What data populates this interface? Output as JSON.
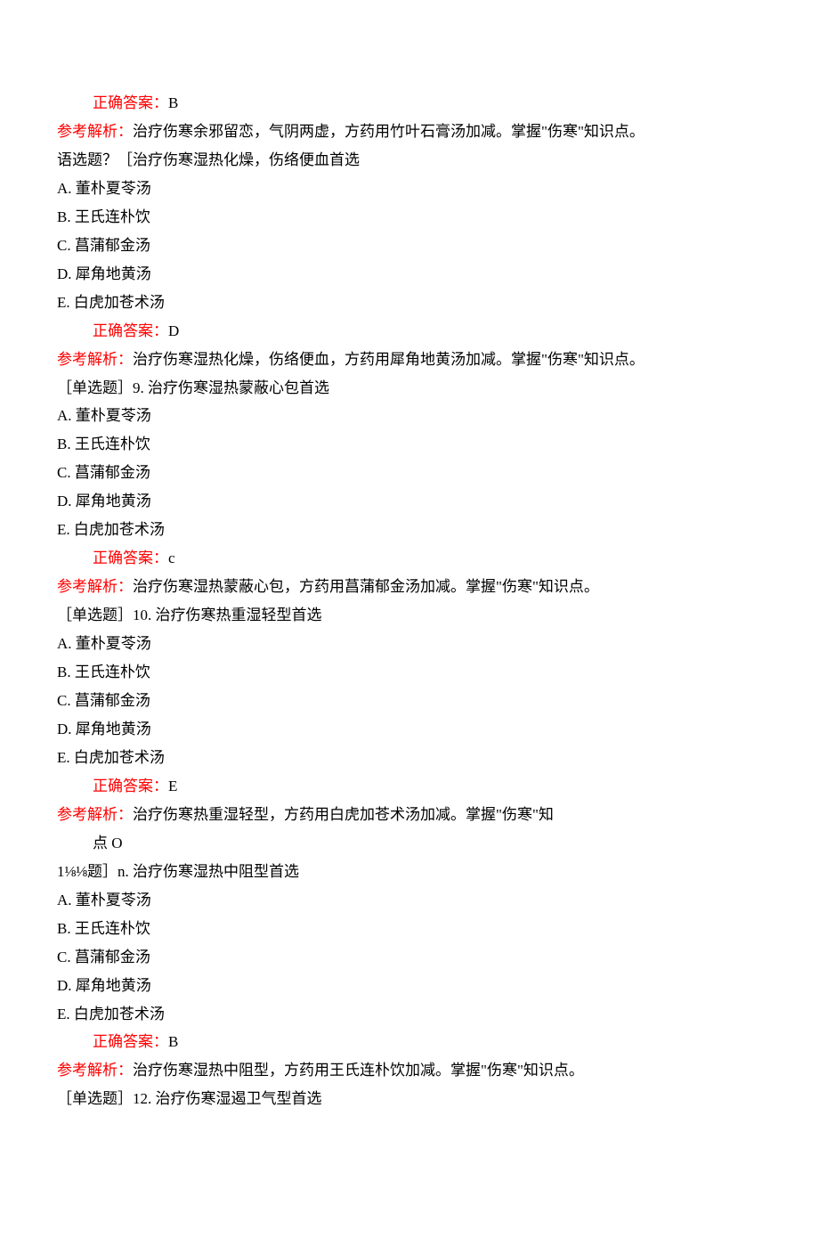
{
  "block_top": {
    "answer_label": "正确答案：",
    "answer_value": "B",
    "explain_label": "参考解析：",
    "explain_text": "治疗伤寒余邪留恋，气阴两虚，方药用竹叶石膏汤加减。掌握\"伤寒\"知识点。"
  },
  "q8": {
    "stem": "语选题？［治疗伤寒湿热化燥，伤络便血首选",
    "options": [
      "A. 董朴夏苓汤",
      "B. 王氏连朴饮",
      "C. 菖蒲郁金汤",
      "D. 犀角地黄汤",
      "E. 白虎加苍术汤"
    ],
    "answer_label": "正确答案：",
    "answer_value": "D",
    "explain_label": "参考解析：",
    "explain_text": "治疗伤寒湿热化燥，伤络便血，方药用犀角地黄汤加减。掌握\"伤寒\"知识点。"
  },
  "q9": {
    "stem": "［单选题］9. 治疗伤寒湿热蒙蔽心包首选",
    "options": [
      "A. 董朴夏苓汤",
      "B. 王氏连朴饮",
      "C. 菖蒲郁金汤",
      "D. 犀角地黄汤",
      "E. 白虎加苍术汤"
    ],
    "answer_label": "正确答案：",
    "answer_value": "c",
    "explain_label": "参考解析：",
    "explain_text": "治疗伤寒湿热蒙蔽心包，方药用菖蒲郁金汤加减。掌握\"伤寒\"知识点。"
  },
  "q10": {
    "stem": "［单选题］10. 治疗伤寒热重湿轻型首选",
    "options": [
      "A. 董朴夏苓汤",
      "B. 王氏连朴饮",
      "C. 菖蒲郁金汤",
      "D. 犀角地黄汤",
      "E. 白虎加苍术汤"
    ],
    "answer_label": "正确答案：",
    "answer_value": "E",
    "explain_label": "参考解析：",
    "explain_text_part1": "治疗伤寒热重湿轻型，方药用白虎加苍术汤加减。掌握\"伤寒\"知",
    "explain_text_part2": "点 O"
  },
  "q11": {
    "stem": "1⅛⅛题］n. 治疗伤寒湿热中阻型首选",
    "options": [
      "A. 董朴夏苓汤",
      "B. 王氏连朴饮",
      "C. 菖蒲郁金汤",
      "D. 犀角地黄汤",
      "E. 白虎加苍术汤"
    ],
    "answer_label": "正确答案：",
    "answer_value": "B",
    "explain_label": "参考解析：",
    "explain_text": "治疗伤寒湿热中阻型，方药用王氏连朴饮加减。掌握\"伤寒\"知识点。"
  },
  "q12": {
    "stem": "［单选题］12. 治疗伤寒湿遏卫气型首选"
  }
}
